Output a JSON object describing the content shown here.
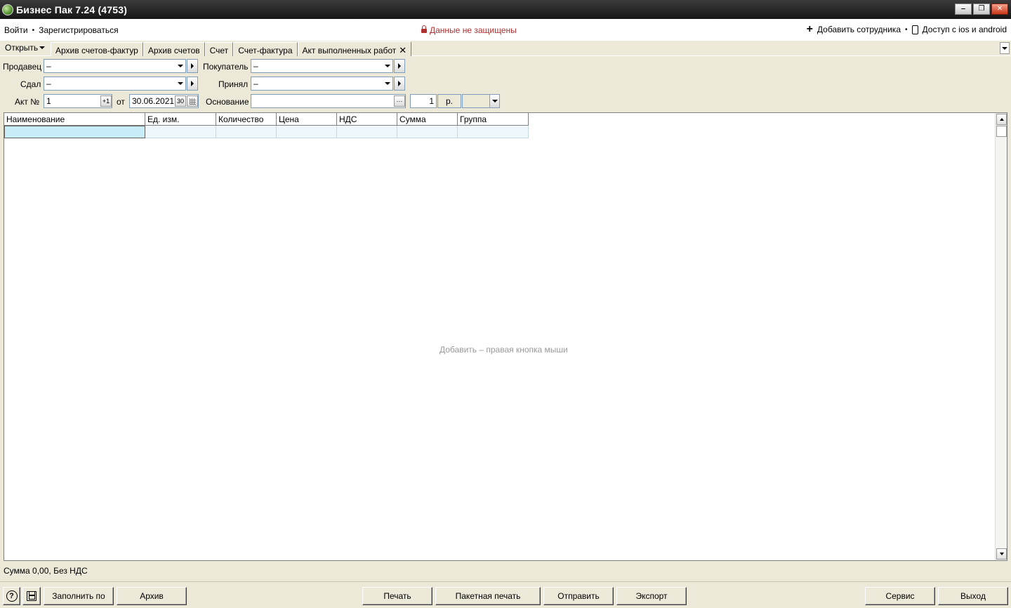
{
  "window": {
    "title": "Бизнес Пак 7.24 (4753)",
    "minimize": "‒",
    "restore": "❐",
    "close": "✕"
  },
  "menu": {
    "login": "Войти",
    "register": "Зарегистрироваться",
    "security_status": "Данные не защищены",
    "add_employee": "Добавить сотрудника",
    "mobile_access": "Доступ с ios и android",
    "separator": "•"
  },
  "tabs": {
    "open_label": "Открыть",
    "items": [
      {
        "label": "Архив счетов-фактур"
      },
      {
        "label": "Архив счетов"
      },
      {
        "label": "Счет"
      },
      {
        "label": "Счет-фактура"
      },
      {
        "label": "Акт выполненных работ"
      }
    ],
    "close_glyph": "✕"
  },
  "form": {
    "seller_label": "Продавец",
    "seller_value": "–",
    "buyer_label": "Покупатель",
    "buyer_value": "–",
    "handed_label": "Сдал",
    "handed_value": "–",
    "accepted_label": "Принял",
    "accepted_value": "–",
    "act_no_label": "Акт №",
    "act_no_value": "1",
    "increment_label": "+1",
    "from_label": "от",
    "date_value": "30.06.2021",
    "day_label": "30",
    "basis_label": "Основание",
    "basis_value": "",
    "ellipsis": "···",
    "rate_value": "1",
    "currency_label": "р.",
    "currency_select": ""
  },
  "grid": {
    "columns": [
      "Наименование",
      "Ед. изм.",
      "Количество",
      "Цена",
      "НДС",
      "Сумма",
      "Группа"
    ],
    "hint": "Добавить – правая кнопка мыши"
  },
  "status": {
    "summary": "Сумма 0,00, Без НДС"
  },
  "buttons": {
    "help": "?",
    "fill_by": "Заполнить по",
    "archive": "Архив",
    "print": "Печать",
    "batch_print": "Пакетная печать",
    "send": "Отправить",
    "export": "Экспорт",
    "service": "Сервис",
    "exit": "Выход"
  }
}
